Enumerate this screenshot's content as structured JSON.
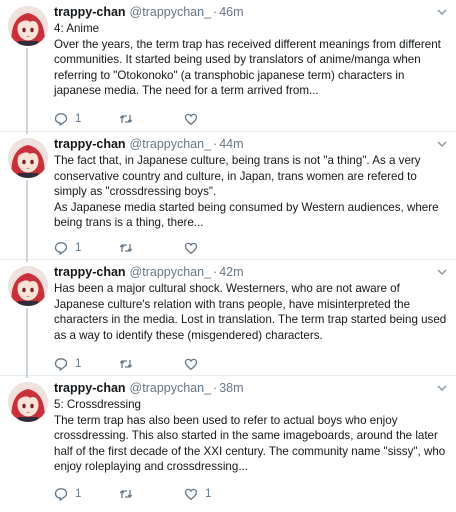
{
  "tweets": [
    {
      "name": "trappy-chan",
      "handle": "@trappychan_",
      "time": "46m",
      "body": "4: Anime\nOver the years, the term trap has received different meanings from different communities. It started being used by translators of anime/manga when referring to \"Otokonoko\" (a transphobic japanese term) characters in japanese media. The need for a term arrived from...",
      "reply_count": "1",
      "retweet_count": "",
      "like_count": ""
    },
    {
      "name": "trappy-chan",
      "handle": "@trappychan_",
      "time": "44m",
      "body": "The fact that, in Japanese culture, being trans is not \"a thing\". As a very conservative country and culture, in Japan, trans women are refered to simply as \"crossdressing boys\".\nAs Japanese media started being consumed by Western audiences, where being trans is a thing, there...",
      "reply_count": "1",
      "retweet_count": "",
      "like_count": ""
    },
    {
      "name": "trappy-chan",
      "handle": "@trappychan_",
      "time": "42m",
      "body": "Has been a major cultural shock. Westerners, who are not aware of Japanese culture's relation with trans people, have misinterpreted the characters in the media. Lost in translation. The term trap started being used as a way to identify these (misgendered) characters.",
      "reply_count": "1",
      "retweet_count": "",
      "like_count": ""
    },
    {
      "name": "trappy-chan",
      "handle": "@trappychan_",
      "time": "38m",
      "body": "5: Crossdressing\nThe term trap has also been used to refer to actual boys who enjoy crossdressing. This also started in the same imageboards, around the later half of the first decade of the XXI century. The community name \"sissy\", who enjoy roleplaying and crossdressing...",
      "reply_count": "1",
      "retweet_count": "",
      "like_count": "1"
    }
  ],
  "colors": {
    "text": "#14171a",
    "muted": "#657786",
    "border": "#e6ecf0",
    "avatar_hair": "#c9313a",
    "avatar_skin": "#fbe3d6"
  },
  "icons": [
    "chevron-down-icon",
    "reply-icon",
    "retweet-icon",
    "like-icon"
  ]
}
